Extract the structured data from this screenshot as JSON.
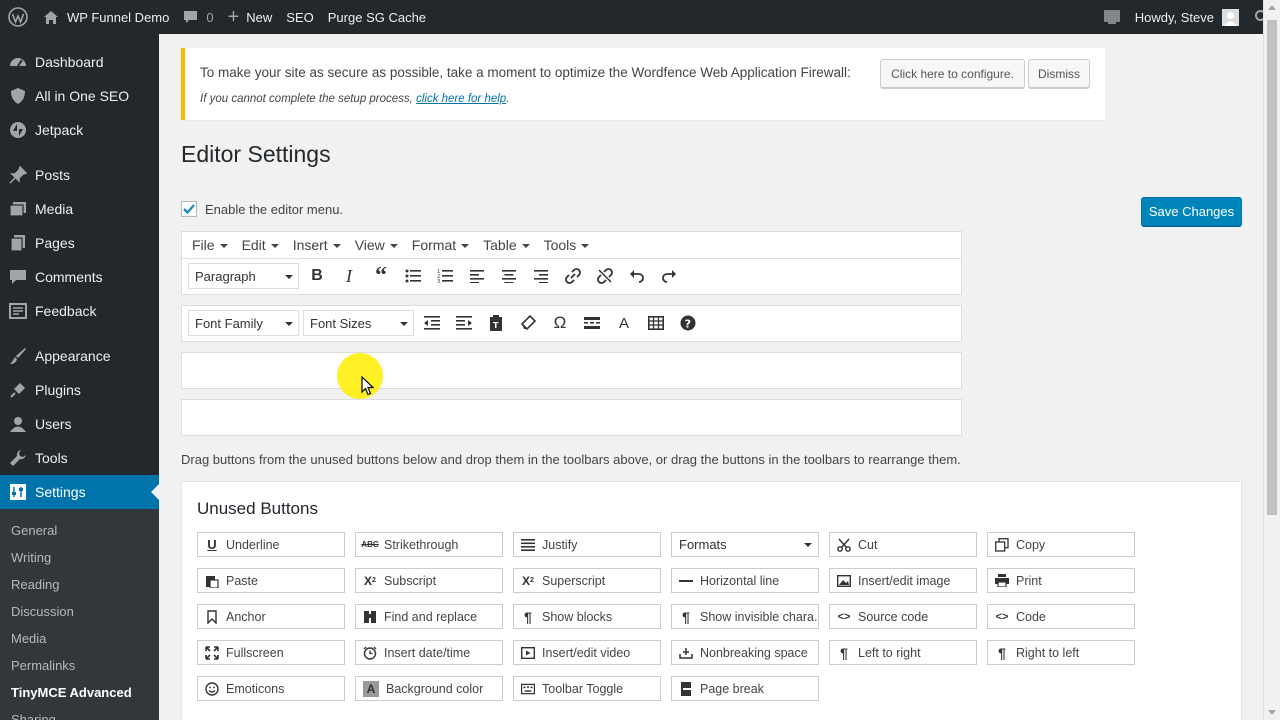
{
  "adminbar": {
    "site_name": "WP Funnel Demo",
    "comments_count": "0",
    "new_label": "New",
    "seo_label": "SEO",
    "purge_label": "Purge SG Cache",
    "howdy": "Howdy, Steve"
  },
  "sidebar": {
    "items": [
      {
        "label": "Dashboard",
        "icon": "dashboard-icon"
      },
      {
        "label": "All in One SEO",
        "icon": "shield-icon"
      },
      {
        "label": "Jetpack",
        "icon": "jetpack-icon"
      },
      {
        "label": "Posts",
        "icon": "pin-icon"
      },
      {
        "label": "Media",
        "icon": "media-icon"
      },
      {
        "label": "Pages",
        "icon": "pages-icon"
      },
      {
        "label": "Comments",
        "icon": "comment-icon"
      },
      {
        "label": "Feedback",
        "icon": "feedback-icon"
      },
      {
        "label": "Appearance",
        "icon": "brush-icon"
      },
      {
        "label": "Plugins",
        "icon": "plug-icon"
      },
      {
        "label": "Users",
        "icon": "users-icon"
      },
      {
        "label": "Tools",
        "icon": "wrench-icon"
      },
      {
        "label": "Settings",
        "icon": "settings-icon"
      }
    ],
    "submenu": [
      "General",
      "Writing",
      "Reading",
      "Discussion",
      "Media",
      "Permalinks",
      "TinyMCE Advanced",
      "Sharing"
    ]
  },
  "notice": {
    "text": "To make your site as secure as possible, take a moment to optimize the Wordfence Web Application Firewall:",
    "configure_label": "Click here to configure.",
    "dismiss_label": "Dismiss",
    "sub_text": "If you cannot complete the setup process,",
    "sub_link": "click here for help",
    "sub_end": "."
  },
  "page": {
    "title": "Editor Settings",
    "enable_label": "Enable the editor menu.",
    "save_label": "Save Changes",
    "help_text": "Drag buttons from the unused buttons below and drop them in the toolbars above, or drag the buttons in the toolbars to rearrange them."
  },
  "editor": {
    "menubar": [
      "File",
      "Edit",
      "Insert",
      "View",
      "Format",
      "Table",
      "Tools"
    ],
    "paragraph_select": "Paragraph",
    "font_family_select": "Font Family",
    "font_sizes_select": "Font Sizes"
  },
  "unused": {
    "title": "Unused Buttons",
    "formats_select": "Formats",
    "buttons": {
      "underline": "Underline",
      "strikethrough": "Strikethrough",
      "justify": "Justify",
      "cut": "Cut",
      "copy": "Copy",
      "paste": "Paste",
      "subscript": "Subscript",
      "superscript": "Superscript",
      "horizontal_line": "Horizontal line",
      "insert_image": "Insert/edit image",
      "print": "Print",
      "anchor": "Anchor",
      "find_replace": "Find and replace",
      "show_blocks": "Show blocks",
      "show_invisible": "Show invisible chara...",
      "source_code": "Source code",
      "code": "Code",
      "fullscreen": "Fullscreen",
      "insert_datetime": "Insert date/time",
      "insert_video": "Insert/edit video",
      "nbsp": "Nonbreaking space",
      "ltr": "Left to right",
      "rtl": "Right to left",
      "emoticons": "Emoticons",
      "bg_color": "Background color",
      "toolbar_toggle": "Toolbar Toggle",
      "page_break": "Page break"
    }
  },
  "colors": {
    "accent": "#0073aa",
    "notice_border": "#ffb900",
    "sidebar_bg": "#23282d"
  }
}
